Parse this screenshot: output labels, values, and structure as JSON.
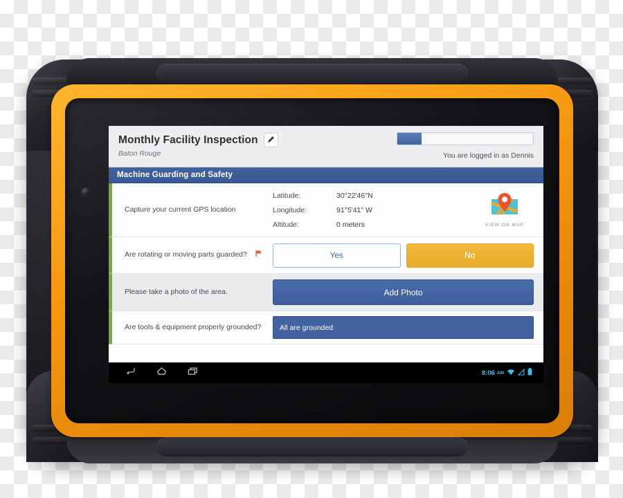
{
  "device": {
    "name": "rugged-android-tablet",
    "case_color": "#f59a12",
    "shell_color": "#1b1b20"
  },
  "screen": {
    "header": {
      "title": "Monthly Facility Inspection",
      "edit_icon": "pencil-icon",
      "subtitle": "Baton Rouge",
      "logged_in_text": "You are logged in as Dennis",
      "progress_percent": 18
    },
    "section": {
      "title": "Machine Guarding and Safety",
      "color": "#42639f"
    },
    "rows": [
      {
        "type": "gps",
        "label": "Capture your current GPS location",
        "fields": [
          {
            "key": "Latitude:",
            "value": "30°22'46\"N"
          },
          {
            "key": "Longitude:",
            "value": "91°5'41\" W"
          },
          {
            "key": "Altitude:",
            "value": "0 meters"
          }
        ],
        "map_icon": "map-pin-icon",
        "map_caption": "VIEW ON MAP"
      },
      {
        "type": "choice",
        "label": "Are rotating or moving parts guarded?",
        "flag_icon": "flag-icon",
        "flag_color": "#e8572a",
        "options": [
          {
            "label": "Yes",
            "selected": false
          },
          {
            "label": "No",
            "selected": true
          }
        ]
      },
      {
        "type": "photo",
        "label": "Please take a photo of the area.",
        "button_label": "Add Photo"
      },
      {
        "type": "answer",
        "label": "Are tools & equipment properly grounded?",
        "value": "All are grounded"
      }
    ]
  },
  "nav_bar": {
    "keys": [
      {
        "name": "back-icon"
      },
      {
        "name": "home-icon"
      },
      {
        "name": "recents-icon"
      }
    ],
    "time": "8:06",
    "ampm": "AM",
    "status_icons": [
      "wifi-icon",
      "signal-icon",
      "battery-icon"
    ],
    "accent_color": "#38c0e8"
  },
  "bezel_keys": [
    {
      "name": "search-icon"
    },
    {
      "name": "back-icon"
    },
    {
      "name": "home-icon"
    },
    {
      "name": "menu-icon"
    }
  ]
}
